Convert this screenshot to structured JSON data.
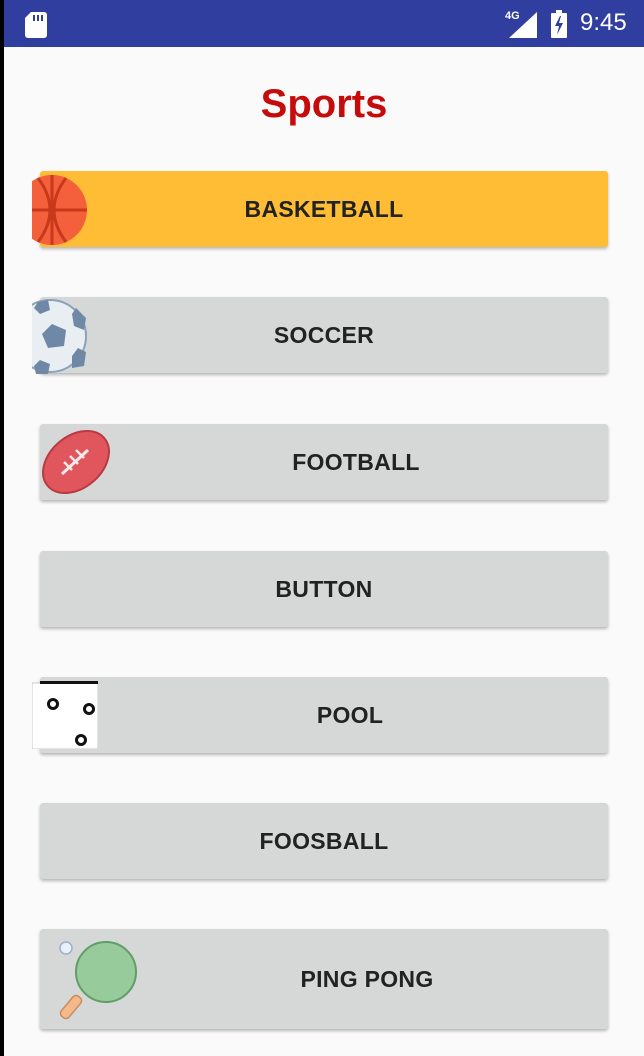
{
  "status_bar": {
    "network": "4G",
    "time": "9:45",
    "color": "#303f9f"
  },
  "page": {
    "title": "Sports",
    "title_color": "#c60b0b"
  },
  "buttons": [
    {
      "label": "BASKETBALL",
      "icon": "basketball-icon",
      "selected": true,
      "color": "#ffbd35"
    },
    {
      "label": "SOCCER",
      "icon": "soccer-ball-icon",
      "selected": false
    },
    {
      "label": "FOOTBALL",
      "icon": "football-icon",
      "selected": false
    },
    {
      "label": "BUTTON",
      "icon": null,
      "selected": false
    },
    {
      "label": "POOL",
      "icon": "dice-icon",
      "selected": false
    },
    {
      "label": "FOOSBALL",
      "icon": null,
      "selected": false
    },
    {
      "label": "PING PONG",
      "icon": "ping-pong-paddle-icon",
      "selected": false
    }
  ]
}
